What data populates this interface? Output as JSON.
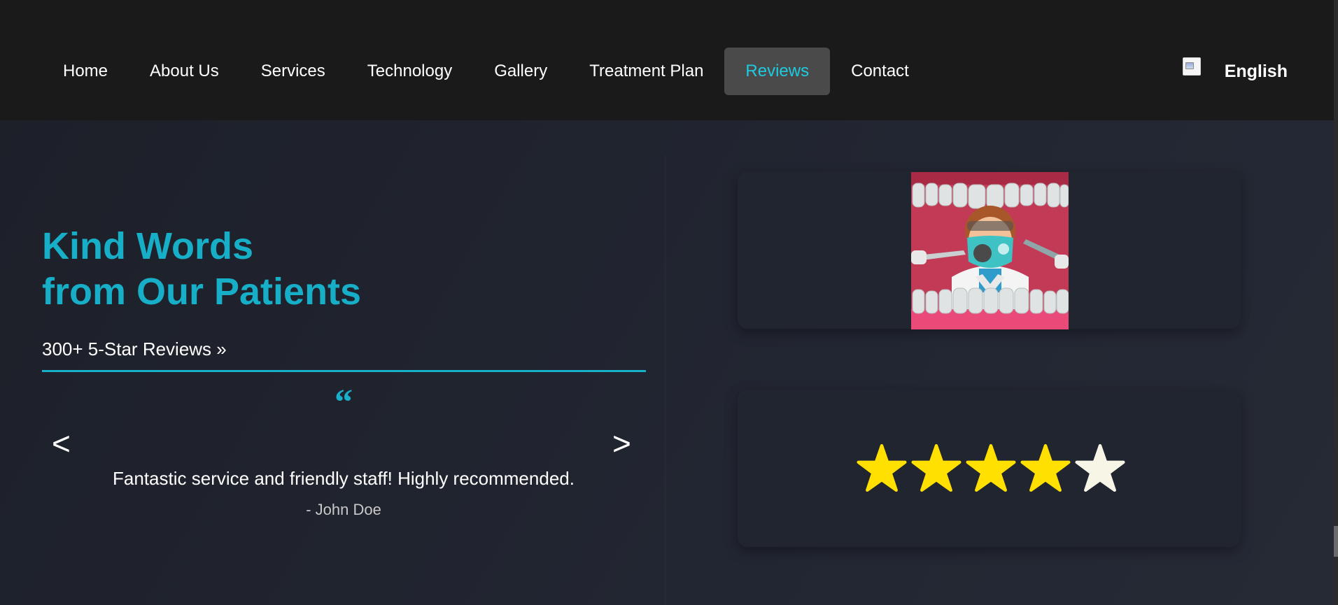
{
  "nav": {
    "items": [
      {
        "label": "Home"
      },
      {
        "label": "About Us"
      },
      {
        "label": "Services"
      },
      {
        "label": "Technology"
      },
      {
        "label": "Gallery"
      },
      {
        "label": "Treatment Plan"
      },
      {
        "label": "Reviews",
        "active": true
      },
      {
        "label": "Contact"
      }
    ],
    "language": "English",
    "accent_color": "#1ecbe1"
  },
  "hero": {
    "heading_line1": "Kind Words",
    "heading_line2": "from Our Patients",
    "reviews_link": "300+ 5-Star Reviews »",
    "quote_mark": "“",
    "prev_arrow": "<",
    "next_arrow": ">",
    "accent_color": "#17aec7"
  },
  "review": {
    "text": "Fantastic service and friendly staff! Highly recommended.",
    "author": "- John Doe"
  },
  "rating": {
    "value": 4,
    "max": 5,
    "filled_color": "#ffe000",
    "empty_color": "#f7f5e6"
  },
  "image": {
    "icon": "dentist-illustration-icon"
  }
}
